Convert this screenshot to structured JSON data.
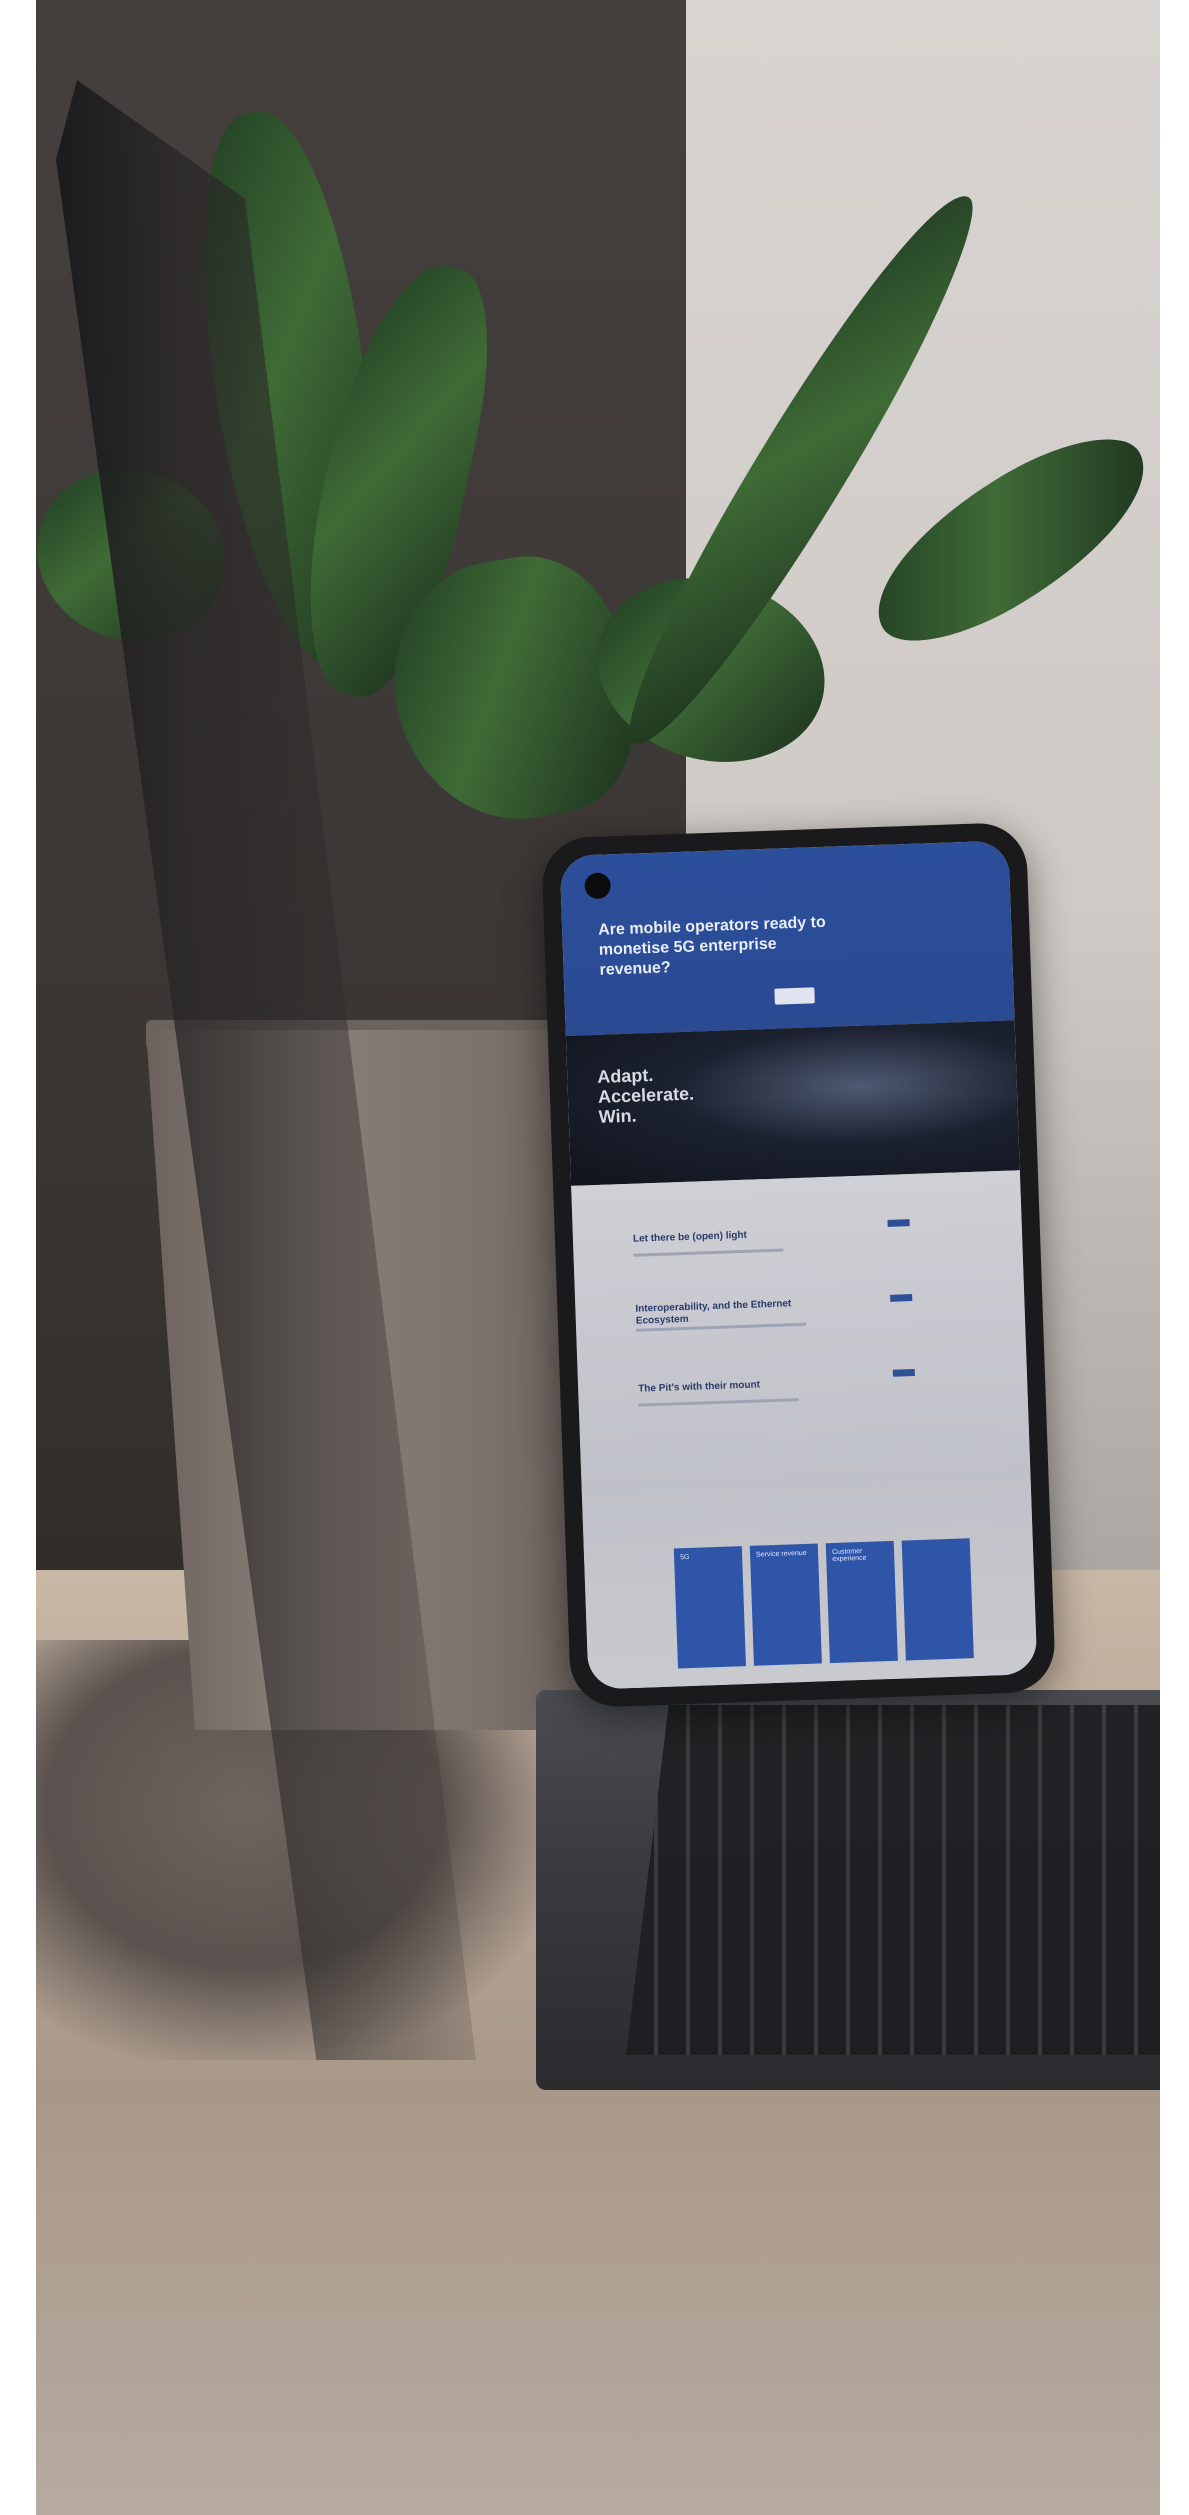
{
  "scene": {
    "description_elements": [
      "laptop",
      "smartphone",
      "potted-plant",
      "table",
      "wall"
    ]
  },
  "phone_screen": {
    "hero_title": "Are mobile operators ready to monetise 5G enterprise revenue?",
    "band_title": "Adapt. Accelerate. Win.",
    "rows": [
      "Let there be (open) light",
      "Interoperability, and the Ethernet Ecosystem",
      "The Pit's with their mount"
    ],
    "cards": [
      "5G",
      "Service revenue",
      "Customer experience",
      ""
    ]
  },
  "colors": {
    "screen_blue": "#2c4f9b",
    "card_blue": "#2f55a8",
    "leaf_green": "#3f6b36"
  }
}
